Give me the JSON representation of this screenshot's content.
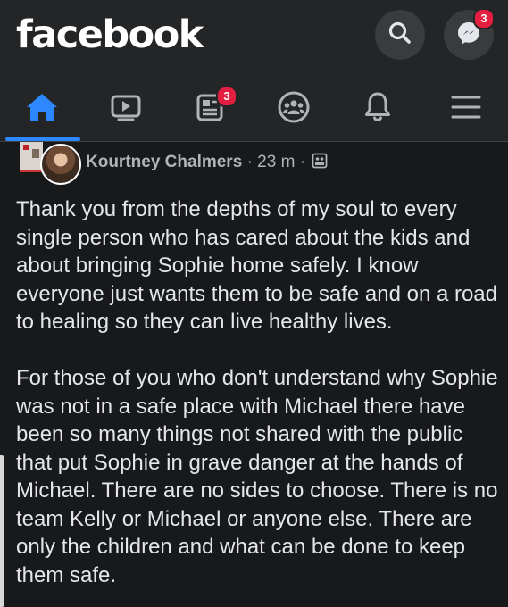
{
  "app": {
    "logo": "facebook"
  },
  "header": {
    "search_icon": "search-icon",
    "messenger_icon": "messenger-icon",
    "messenger_badge": "3"
  },
  "nav": {
    "items": [
      {
        "name": "home",
        "icon": "home-icon",
        "active": true
      },
      {
        "name": "watch",
        "icon": "video-icon"
      },
      {
        "name": "news",
        "icon": "news-feed-icon",
        "badge": "3"
      },
      {
        "name": "groups",
        "icon": "groups-icon"
      },
      {
        "name": "notifications",
        "icon": "bell-icon"
      },
      {
        "name": "menu",
        "icon": "hamburger-icon"
      }
    ],
    "active_color": "#2d88ff"
  },
  "post": {
    "author": "Kourtney Chalmers",
    "separator": "·",
    "time": "23 m",
    "audience_icon": "privacy-icon",
    "paragraphs": [
      "Thank you from the depths of my soul to every single person who has cared about the kids and about bringing Sophie home safely. I know everyone just wants them to be safe and on a road to healing so they can live healthy lives.",
      "For those of you who don't understand why Sophie was not in a safe place with Michael there have been so many things not shared with the public that put Sophie in grave danger at the hands of Michael. There are no sides to choose. There is no team Kelly or Michael or anyone else. There are only the children and what can be done to keep them safe."
    ]
  },
  "colors": {
    "background": "#18191a",
    "bar": "#242526",
    "text": "#e4e6eb",
    "secondary_text": "#b0b3b8",
    "badge": "#e41e3f"
  }
}
